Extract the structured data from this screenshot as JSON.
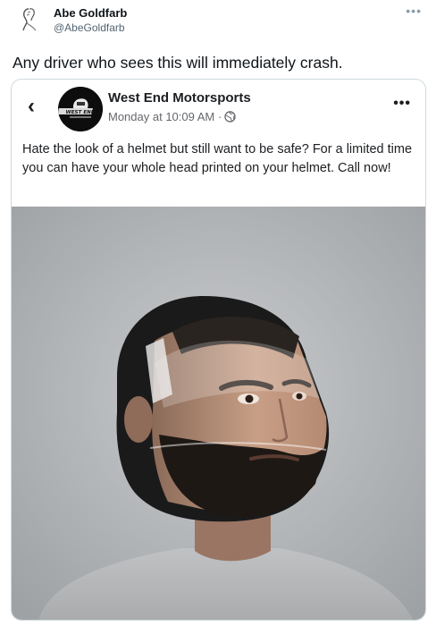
{
  "tweet": {
    "author_name": "Abe Goldfarb",
    "author_handle": "@AbeGoldfarb",
    "more_icon": "more-horizontal-icon",
    "text": "Any driver who sees this will immediately crash."
  },
  "facebook_post": {
    "back_icon": "chevron-left-icon",
    "page_name": "West End Motorsports",
    "page_logo_text": "WEST END",
    "timestamp": "Monday at 10:09 AM · ",
    "privacy_icon": "globe-icon",
    "more_icon": "more-horizontal-icon",
    "text": "Hate the look of a helmet but still want to be safe? For a limited time you can have your whole head printed on your helmet. Call now!",
    "photo_alt": "Man wearing a full-face motorcycle helmet printed with his own face and beard"
  },
  "colors": {
    "fb_text": "#1c1e21",
    "fb_meta": "#65676b",
    "twitter_handle": "#536471",
    "card_border": "#cfd9de",
    "photo_background": "#b7b9bb"
  }
}
